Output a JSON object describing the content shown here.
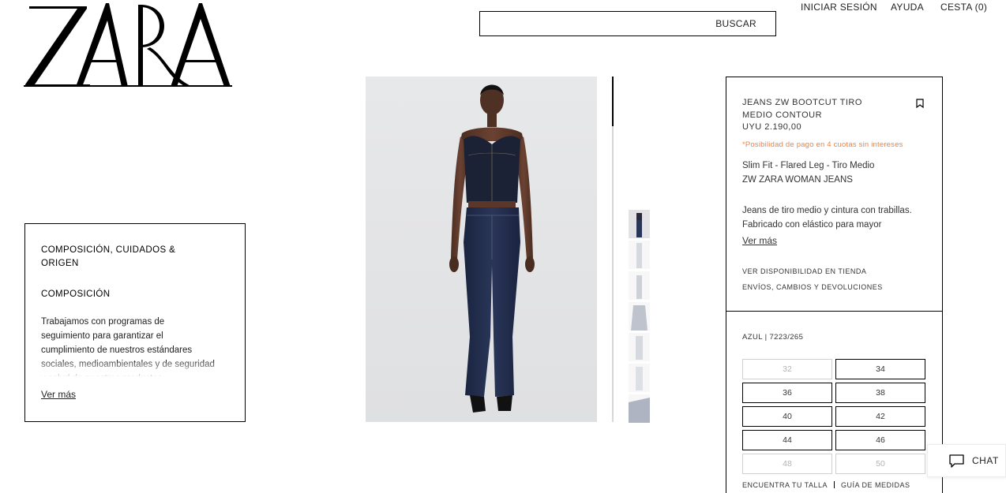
{
  "brand": {
    "logo_text": "ZARA"
  },
  "header": {
    "search_button": "BUSCAR",
    "search_value": "",
    "nav": {
      "login": "INICIAR SESIÓN",
      "help": "AYUDA",
      "cart": "CESTA (0)"
    }
  },
  "composition": {
    "title": "COMPOSICIÓN, CUIDADOS & ORIGEN",
    "subtitle": "COMPOSICIÓN",
    "body": "Trabajamos con programas de seguimiento para garantizar el cumplimiento de nuestros estándares sociales, medioambientales y de seguridad y salud de nuestros productos.",
    "more": "Ver más"
  },
  "product": {
    "name": "JEANS ZW BOOTCUT TIRO MEDIO CONTOUR",
    "price": "UYU 2.190,00",
    "installments": "*Posibilidad de pago en 4 cuotas sin intereses",
    "fit": "Slim Fit - Flared Leg - Tiro Medio",
    "collection": "ZW ZARA WOMAN JEANS",
    "description": "Jeans de tiro medio y cintura con trabillas. Fabricado con elástico para mayor comodidad.",
    "more": "Ver más",
    "store_link": "VER DISPONIBILIDAD EN TIENDA",
    "shipping_link": "ENVÍOS, CAMBIOS Y DEVOLUCIONES"
  },
  "sizes": {
    "color_ref": "AZUL | 7223/265",
    "items": [
      {
        "label": "32",
        "available": false
      },
      {
        "label": "34",
        "available": true
      },
      {
        "label": "36",
        "available": true
      },
      {
        "label": "38",
        "available": true
      },
      {
        "label": "40",
        "available": true
      },
      {
        "label": "42",
        "available": true
      },
      {
        "label": "44",
        "available": true
      },
      {
        "label": "46",
        "available": true
      },
      {
        "label": "48",
        "available": false
      },
      {
        "label": "50",
        "available": false
      }
    ],
    "find_size": "ENCUENTRA TU TALLA",
    "size_guide": "GUÍA DE MEDIDAS"
  },
  "chat": {
    "label": "CHAT"
  },
  "gallery": {
    "thumb_count": 7,
    "active_index": 0
  },
  "colors": {
    "accent_orange": "#e8844a",
    "denim": "#1f2a44",
    "border": "#000000"
  }
}
